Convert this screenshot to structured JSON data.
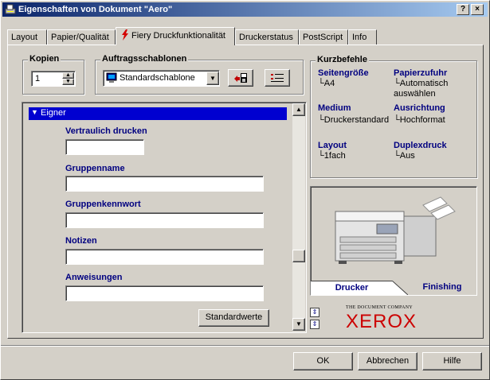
{
  "window": {
    "title": "Eigenschaften von Dokument \"Aero\"",
    "help_btn": "?",
    "close_btn": "×"
  },
  "tabs": [
    {
      "label": "Layout"
    },
    {
      "label": "Papier/Qualität"
    },
    {
      "label": "Fiery Druckfunktionalität"
    },
    {
      "label": "Druckerstatus"
    },
    {
      "label": "PostScript"
    },
    {
      "label": "Info"
    }
  ],
  "copies": {
    "label": "Kopien",
    "value": "1"
  },
  "templates": {
    "label": "Auftragsschablonen",
    "selected": "Standardschablone"
  },
  "shortcuts": {
    "label": "Kurzbefehle",
    "items": [
      {
        "title": "Seitengröße",
        "value": "A4"
      },
      {
        "title": "Papierzufuhr",
        "value": "Automatisch auswählen"
      },
      {
        "title": "Medium",
        "value": "Druckerstandard"
      },
      {
        "title": "Ausrichtung",
        "value": "Hochformat"
      },
      {
        "title": "Layout",
        "value": "1fach"
      },
      {
        "title": "Duplexdruck",
        "value": "Aus"
      }
    ]
  },
  "section": {
    "header": "Eigner",
    "fields": [
      {
        "label": "Vertraulich drucken",
        "value": ""
      },
      {
        "label": "Gruppenname",
        "value": ""
      },
      {
        "label": "Gruppenkennwort",
        "value": ""
      },
      {
        "label": "Notizen",
        "value": ""
      },
      {
        "label": "Anweisungen",
        "value": ""
      }
    ],
    "defaults_btn": "Standardwerte"
  },
  "printer_tabs": {
    "drucker": "Drucker",
    "finishing": "Finishing"
  },
  "brand": {
    "tagline": "THE DOCUMENT COMPANY",
    "name": "XEROX",
    "color": "#cc0000"
  },
  "footer": {
    "ok": "OK",
    "cancel": "Abbrechen",
    "help": "Hilfe"
  }
}
